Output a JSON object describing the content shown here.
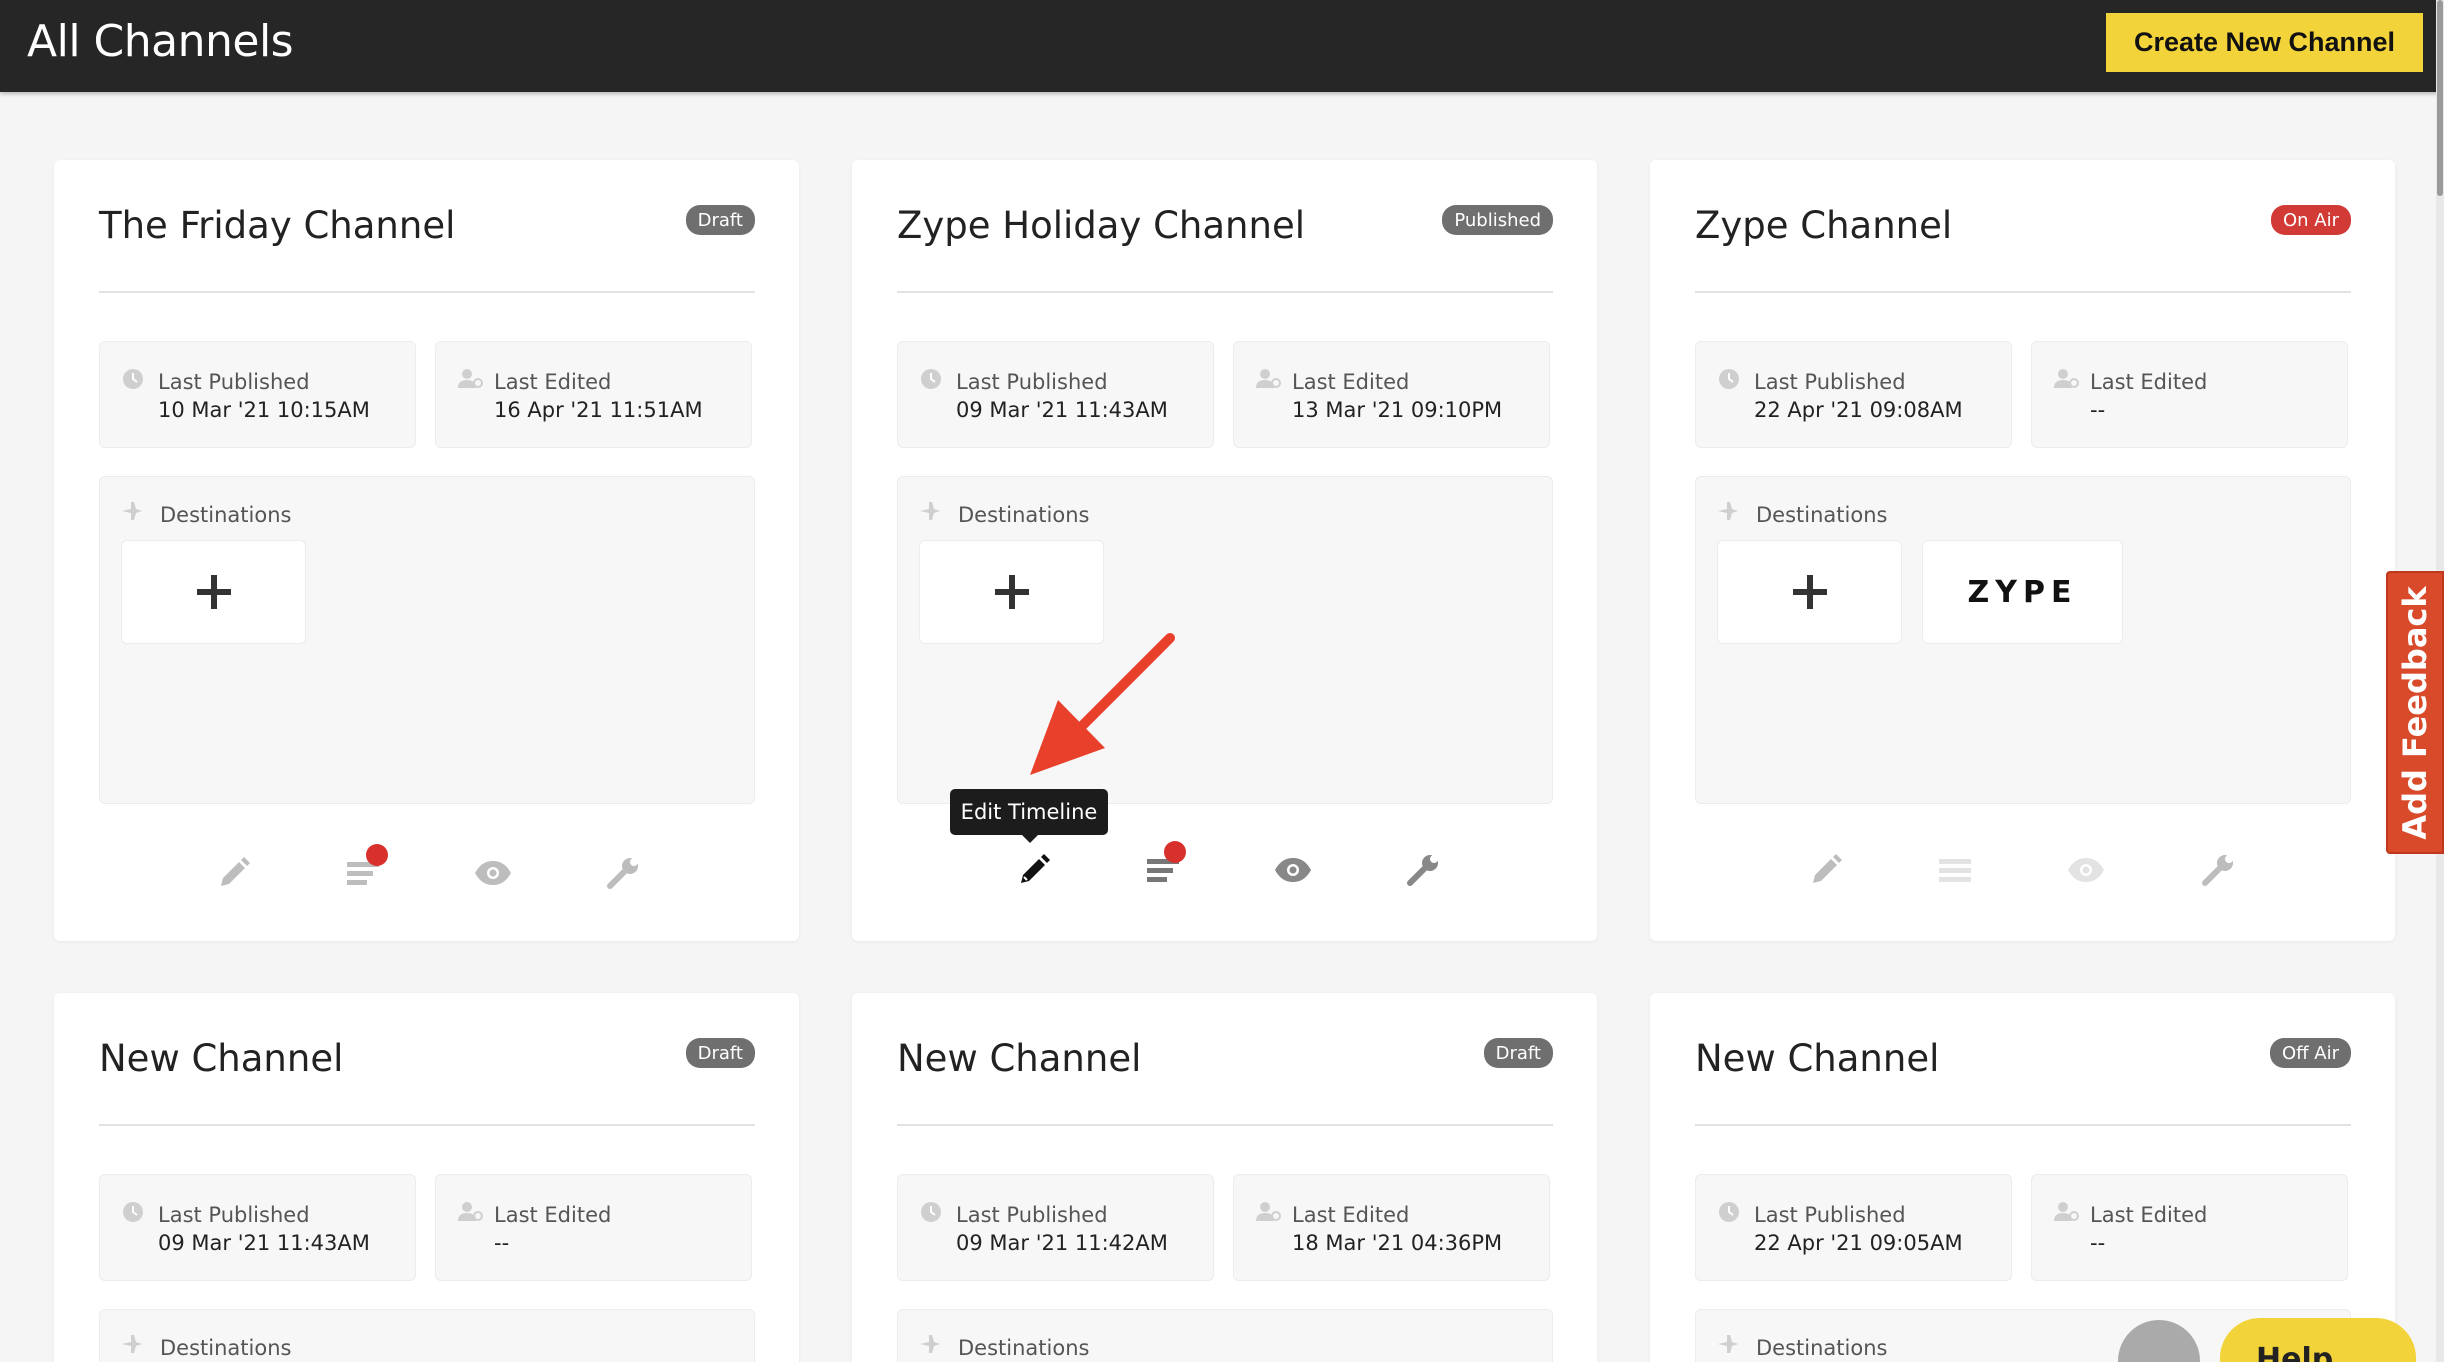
{
  "header": {
    "title": "All Channels",
    "create_button": "Create New Channel"
  },
  "cards": [
    {
      "title": "The Friday Channel",
      "status": "Draft",
      "status_color": "#6f6f6f",
      "last_published_label": "Last Published",
      "last_published": "10 Mar '21 10:15AM",
      "last_edited_label": "Last Edited",
      "last_edited": "16 Apr '21 11:51AM",
      "destinations_label": "Destinations",
      "destinations": []
    },
    {
      "title": "Zype Holiday Channel",
      "status": "Published",
      "status_color": "#6f6f6f",
      "last_published_label": "Last Published",
      "last_published": "09 Mar '21 11:43AM",
      "last_edited_label": "Last Edited",
      "last_edited": "13 Mar '21 09:10PM",
      "destinations_label": "Destinations",
      "destinations": []
    },
    {
      "title": "Zype Channel",
      "status": "On Air",
      "status_color": "#d23a35",
      "last_published_label": "Last Published",
      "last_published": "22 Apr '21 09:08AM",
      "last_edited_label": "Last Edited",
      "last_edited": "--",
      "destinations_label": "Destinations",
      "destinations": [
        "ZYPE"
      ]
    },
    {
      "title": "New Channel",
      "status": "Draft",
      "status_color": "#6f6f6f",
      "last_published_label": "Last Published",
      "last_published": "09 Mar '21 11:43AM",
      "last_edited_label": "Last Edited",
      "last_edited": "--",
      "destinations_label": "Destinations"
    },
    {
      "title": "New Channel",
      "status": "Draft",
      "status_color": "#6f6f6f",
      "last_published_label": "Last Published",
      "last_published": "09 Mar '21 11:42AM",
      "last_edited_label": "Last Edited",
      "last_edited": "18 Mar '21 04:36PM",
      "destinations_label": "Destinations"
    },
    {
      "title": "New Channel",
      "status": "Off Air",
      "status_color": "#6f6f6f",
      "last_published_label": "Last Published",
      "last_published": "22 Apr '21 09:05AM",
      "last_edited_label": "Last Edited",
      "last_edited": "--",
      "destinations_label": "Destinations"
    }
  ],
  "tooltip": "Edit Timeline",
  "feedback_tab": "Add Feedback",
  "help_button": "Help",
  "icons": {
    "clock": "clock-icon",
    "user": "user-icon",
    "plane": "plane-icon",
    "pencil": "pencil-icon",
    "timeline": "timeline-list-icon",
    "eye": "eye-icon",
    "wrench": "wrench-icon"
  },
  "colors": {
    "accent": "#f2d33a",
    "topbar": "#262626",
    "notification_dot": "#d8302d",
    "annotation_arrow": "#e8402a"
  }
}
